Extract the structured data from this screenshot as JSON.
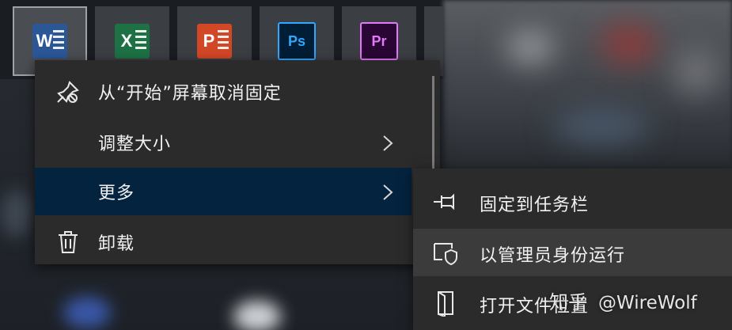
{
  "tiles": [
    {
      "name": "word",
      "letter": "W",
      "color": "#2b5797"
    },
    {
      "name": "excel",
      "letter": "X",
      "color": "#1e7145"
    },
    {
      "name": "powerpoint",
      "letter": "P",
      "color": "#d24726"
    },
    {
      "name": "photoshop",
      "letter": "Ps",
      "color": "#31a8ff"
    },
    {
      "name": "premiere",
      "letter": "Pr",
      "color": "#e379f9"
    }
  ],
  "menu": {
    "items": [
      {
        "label": "从“开始”屏幕取消固定",
        "icon": "unpin-icon"
      },
      {
        "label": "调整大小",
        "icon": "",
        "has_submenu": true
      },
      {
        "label": "更多",
        "icon": "",
        "has_submenu": true,
        "active": true
      },
      {
        "label": "卸载",
        "icon": "trash-icon"
      }
    ]
  },
  "submenu": {
    "items": [
      {
        "label": "固定到任务栏",
        "icon": "pin-icon"
      },
      {
        "label": "以管理员身份运行",
        "icon": "shield-icon",
        "hover": true
      },
      {
        "label": "打开文件位置",
        "icon": "folder-icon"
      }
    ]
  },
  "watermark": {
    "site": "知乎",
    "handle": "@WireWolf"
  },
  "colors": {
    "menu_bg": "#2b2b2b",
    "active_bg": "#04233f",
    "hover_bg": "#3b3b3b",
    "text": "#f2f2f2"
  }
}
